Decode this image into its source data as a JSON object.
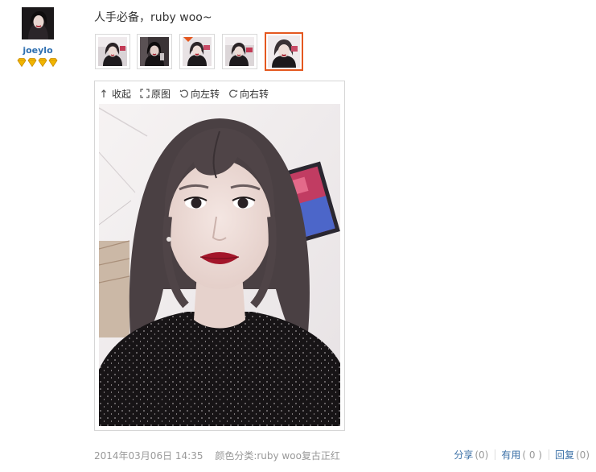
{
  "user": {
    "name": "joeylo",
    "rank_icons": [
      "diamond-icon",
      "diamond-icon",
      "diamond-icon",
      "diamond-icon"
    ],
    "rank_color": "#f2b600"
  },
  "post": {
    "text": "人手必备，ruby woo~"
  },
  "thumbnails": {
    "count": 5,
    "selected_index": 4,
    "active_color": "#e4571f"
  },
  "viewer": {
    "tools": {
      "collapse": "收起",
      "original": "原图",
      "rotate_left": "向左转",
      "rotate_right": "向右转"
    }
  },
  "meta": {
    "time": "2014年03月06日 14:35",
    "category": "颜色分类:ruby woo复古正红"
  },
  "actions": {
    "share_label": "分享",
    "share_count": "(0)",
    "useful_label": "有用",
    "useful_count": "( 0 )",
    "reply_label": "回复",
    "reply_count": "(0)"
  },
  "colors": {
    "link": "#3a6fa6",
    "muted": "#999999",
    "username": "#2e6fb0"
  }
}
